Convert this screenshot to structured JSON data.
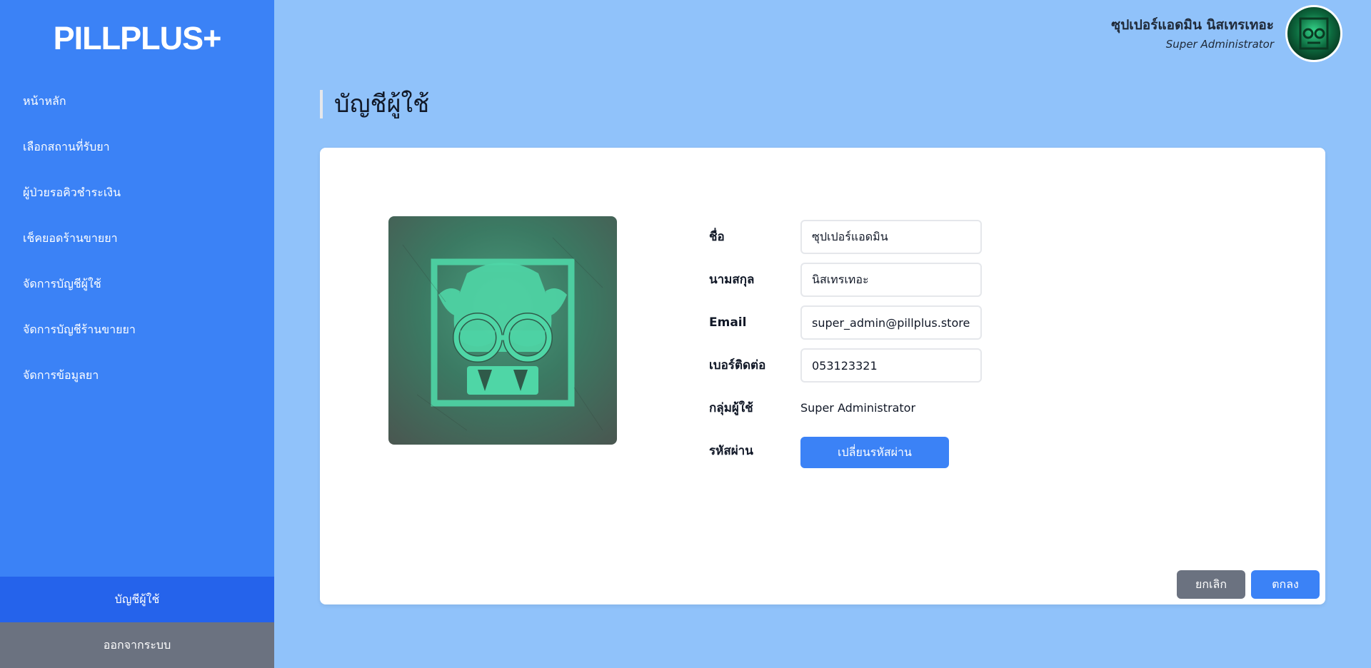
{
  "sidebar": {
    "logo": "PILLPLUS+",
    "items": [
      {
        "label": "หน้าหลัก"
      },
      {
        "label": "เลือกสถานที่รับยา"
      },
      {
        "label": "ผู้ป่วยรอคิวชำระเงิน"
      },
      {
        "label": "เช็คยอดร้านขายยา"
      },
      {
        "label": "จัดการบัญชีผู้ใช้"
      },
      {
        "label": "จัดการบัญชีร้านขายยา"
      },
      {
        "label": "จัดการข้อมูลยา"
      }
    ],
    "account_label": "บัญชีผู้ใช้",
    "logout_label": "ออกจากระบบ"
  },
  "header": {
    "user_name": "ซุปเปอร์แอดมิน นิสเทรเทอะ",
    "user_role": "Super Administrator"
  },
  "page": {
    "title": "บัญชีผู้ใช้"
  },
  "form": {
    "first_name": {
      "label": "ชื่อ",
      "value": "ซุปเปอร์แอดมิน"
    },
    "last_name": {
      "label": "นามสกุล",
      "value": "นิสเทรเทอะ"
    },
    "email": {
      "label": "Email",
      "value": "super_admin@pillplus.store"
    },
    "phone": {
      "label": "เบอร์ติดต่อ",
      "value": "053123321"
    },
    "group": {
      "label": "กลุ่มผู้ใช้",
      "value": "Super Administrator"
    },
    "password": {
      "label": "รหัสผ่าน",
      "button_label": "เปลี่ยนรหัสผ่าน"
    }
  },
  "actions": {
    "cancel_label": "ยกเลิก",
    "ok_label": "ตกลง"
  },
  "colors": {
    "sidebar": "#3b82f6",
    "background": "#90c2fa",
    "primary": "#3b82f6",
    "secondary": "#6b7280"
  }
}
